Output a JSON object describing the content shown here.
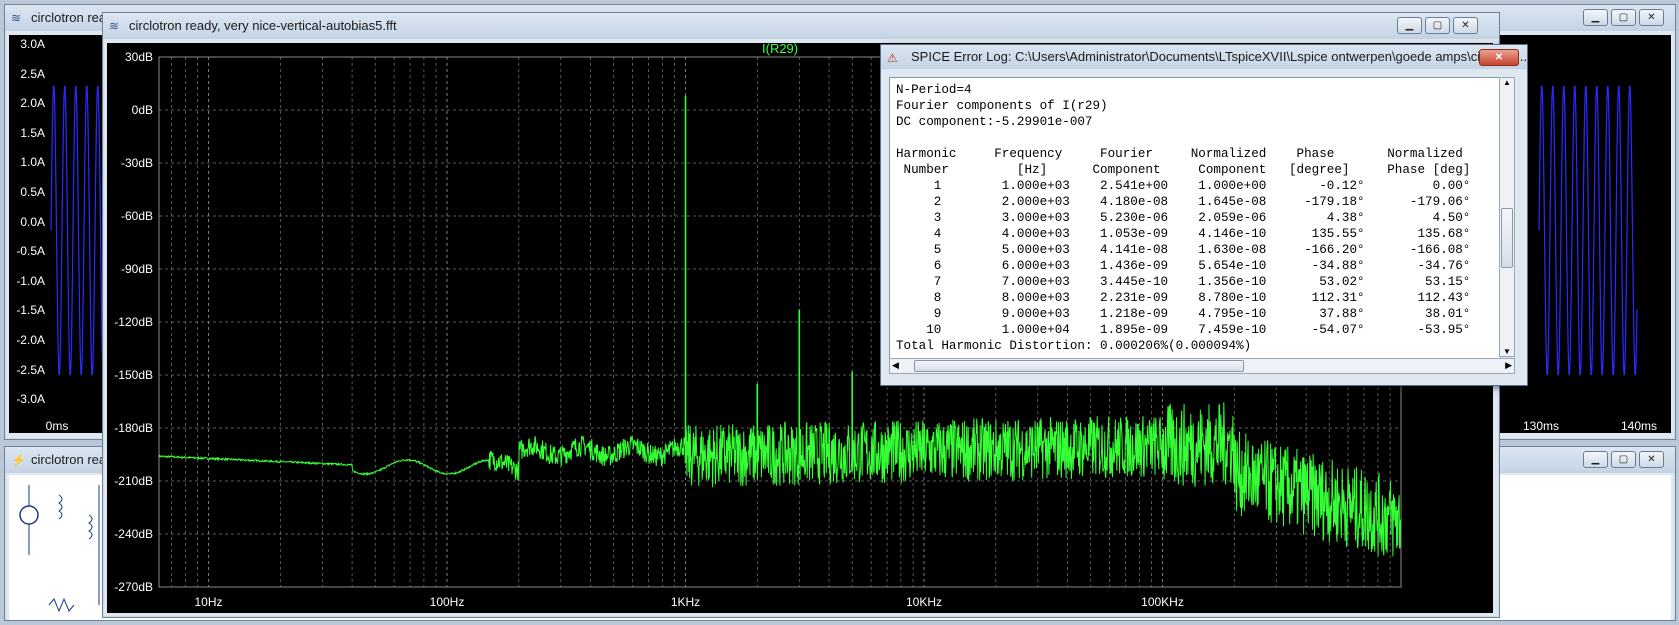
{
  "back_window_top": {
    "title": "circlotron rea",
    "y_ticks": [
      "3.0A",
      "2.5A",
      "2.0A",
      "1.5A",
      "1.0A",
      "0.5A",
      "0.0A",
      "-0.5A",
      "-1.0A",
      "-1.5A",
      "-2.0A",
      "-2.5A",
      "-3.0A"
    ],
    "x_left": "0ms",
    "x_right_1": "130ms",
    "x_right_2": "140ms"
  },
  "back_window_bottom": {
    "title": "circlotron rea"
  },
  "fft_window": {
    "title": "circlotron ready, very nice-vertical-autobias5.fft",
    "trace_label": "I(R29)",
    "y_ticks": [
      "30dB",
      "0dB",
      "-30dB",
      "-60dB",
      "-90dB",
      "-120dB",
      "-150dB",
      "-180dB",
      "-210dB",
      "-240dB",
      "-270dB"
    ],
    "x_ticks": [
      "10Hz",
      "100Hz",
      "1KHz",
      "10KHz",
      "100KHz"
    ]
  },
  "colors": {
    "trace": "#35ff35",
    "blue_trace": "#2b2bff",
    "grid": "#7a7a7a",
    "label": "#3cff3c"
  },
  "error_log": {
    "title": "SPICE Error Log: C:\\Users\\Administrator\\Documents\\LTspiceXVII\\Lspice ontwerpen\\goede amps\\circlotro...",
    "lines": [
      "N-Period=4",
      "Fourier components of I(r29)",
      "DC component:-5.29901e-007",
      "",
      "Harmonic     Frequency     Fourier     Normalized    Phase       Normalized",
      " Number         [Hz]      Component     Component   [degree]     Phase [deg]",
      "     1        1.000e+03    2.541e+00    1.000e+00       -0.12°         0.00°",
      "     2        2.000e+03    4.180e-08    1.645e-08     -179.18°      -179.06°",
      "     3        3.000e+03    5.230e-06    2.059e-06        4.38°         4.50°",
      "     4        4.000e+03    1.053e-09    4.146e-10      135.55°       135.68°",
      "     5        5.000e+03    4.141e-08    1.630e-08     -166.20°      -166.08°",
      "     6        6.000e+03    1.436e-09    5.654e-10      -34.88°       -34.76°",
      "     7        7.000e+03    3.445e-10    1.356e-10       53.02°        53.15°",
      "     8        8.000e+03    2.231e-09    8.780e-10      112.31°       112.43°",
      "     9        9.000e+03    1.218e-09    4.795e-10       37.88°        38.01°",
      "    10        1.000e+04    1.895e-09    7.459e-10      -54.07°       -53.95°",
      "Total Harmonic Distortion: 0.000206%(0.000094%)"
    ]
  }
}
